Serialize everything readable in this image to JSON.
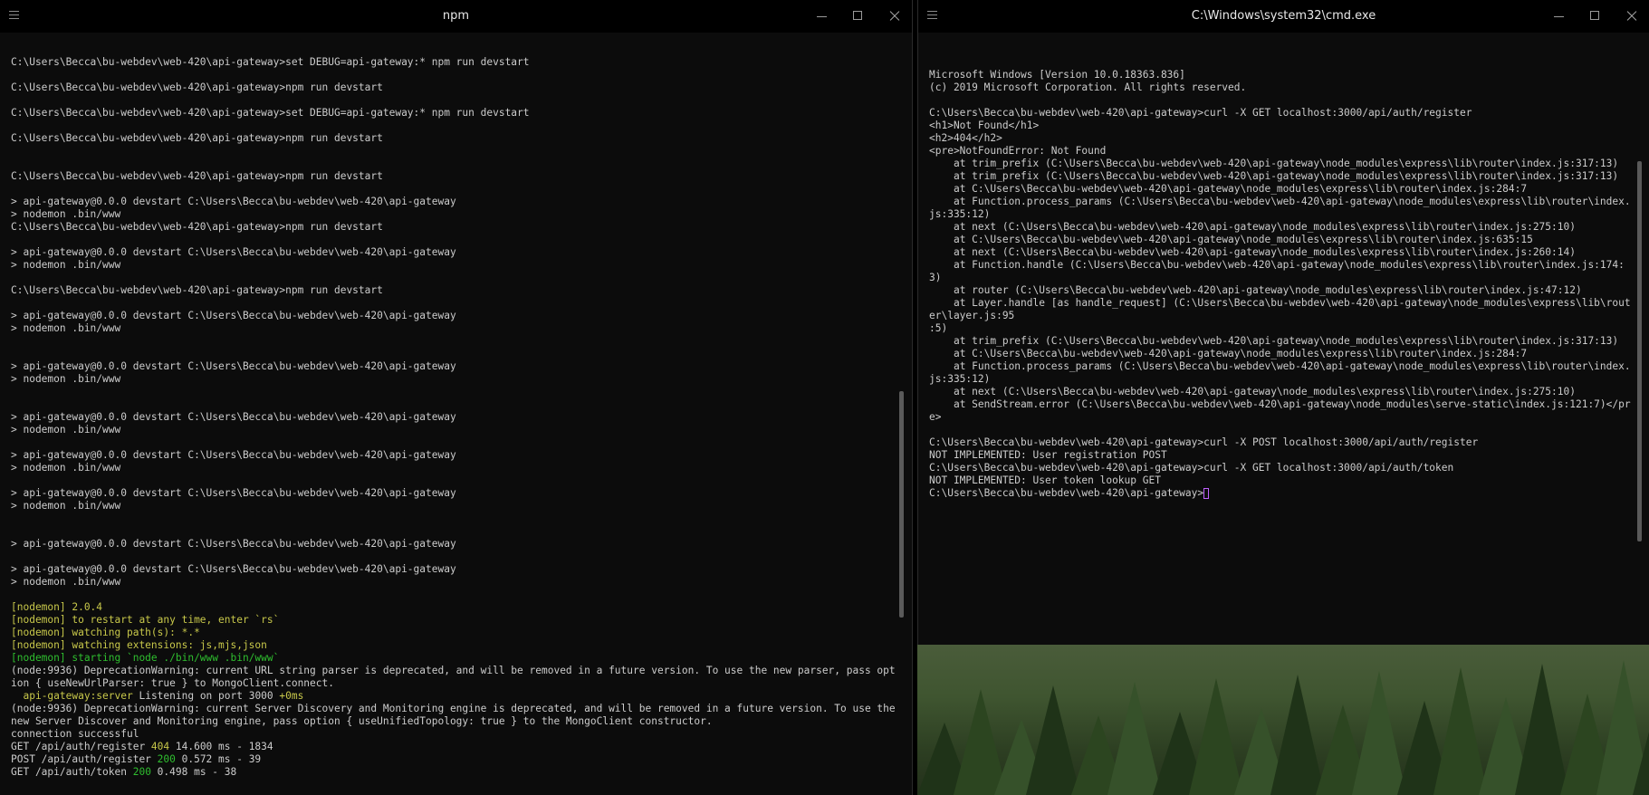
{
  "left_window": {
    "title": "npm",
    "lines": [
      {
        "t": "C:\\Users\\Becca\\bu-webdev\\web-420\\api-gateway>set DEBUG=api-gateway:* npm run devstart"
      },
      {
        "t": ""
      },
      {
        "t": "C:\\Users\\Becca\\bu-webdev\\web-420\\api-gateway>npm run devstart"
      },
      {
        "t": ""
      },
      {
        "t": "C:\\Users\\Becca\\bu-webdev\\web-420\\api-gateway>set DEBUG=api-gateway:* npm run devstart"
      },
      {
        "t": ""
      },
      {
        "t": "C:\\Users\\Becca\\bu-webdev\\web-420\\api-gateway>npm run devstart"
      },
      {
        "t": ""
      },
      {
        "t": ""
      },
      {
        "t": "C:\\Users\\Becca\\bu-webdev\\web-420\\api-gateway>npm run devstart"
      },
      {
        "t": ""
      },
      {
        "t": "> api-gateway@0.0.0 devstart C:\\Users\\Becca\\bu-webdev\\web-420\\api-gateway"
      },
      {
        "t": "> nodemon .bin/www"
      },
      {
        "t": "C:\\Users\\Becca\\bu-webdev\\web-420\\api-gateway>npm run devstart"
      },
      {
        "t": ""
      },
      {
        "t": "> api-gateway@0.0.0 devstart C:\\Users\\Becca\\bu-webdev\\web-420\\api-gateway"
      },
      {
        "t": "> nodemon .bin/www"
      },
      {
        "t": ""
      },
      {
        "t": "C:\\Users\\Becca\\bu-webdev\\web-420\\api-gateway>npm run devstart"
      },
      {
        "t": ""
      },
      {
        "t": "> api-gateway@0.0.0 devstart C:\\Users\\Becca\\bu-webdev\\web-420\\api-gateway"
      },
      {
        "t": "> nodemon .bin/www"
      },
      {
        "t": ""
      },
      {
        "t": ""
      },
      {
        "t": "> api-gateway@0.0.0 devstart C:\\Users\\Becca\\bu-webdev\\web-420\\api-gateway"
      },
      {
        "t": "> nodemon .bin/www"
      },
      {
        "t": ""
      },
      {
        "t": ""
      },
      {
        "t": "> api-gateway@0.0.0 devstart C:\\Users\\Becca\\bu-webdev\\web-420\\api-gateway"
      },
      {
        "t": "> nodemon .bin/www"
      },
      {
        "t": ""
      },
      {
        "t": "> api-gateway@0.0.0 devstart C:\\Users\\Becca\\bu-webdev\\web-420\\api-gateway"
      },
      {
        "t": "> nodemon .bin/www"
      },
      {
        "t": ""
      },
      {
        "t": "> api-gateway@0.0.0 devstart C:\\Users\\Becca\\bu-webdev\\web-420\\api-gateway"
      },
      {
        "t": "> nodemon .bin/www"
      },
      {
        "t": ""
      },
      {
        "t": ""
      },
      {
        "t": "> api-gateway@0.0.0 devstart C:\\Users\\Becca\\bu-webdev\\web-420\\api-gateway"
      },
      {
        "t": ""
      },
      {
        "t": "> api-gateway@0.0.0 devstart C:\\Users\\Becca\\bu-webdev\\web-420\\api-gateway"
      },
      {
        "t": "> nodemon .bin/www"
      },
      {
        "t": ""
      },
      {
        "t": "[nodemon] 2.0.4",
        "c": "y"
      },
      {
        "t": "[nodemon] to restart at any time, enter `rs`",
        "c": "y"
      },
      {
        "t": "[nodemon] watching path(s): *.*",
        "c": "y"
      },
      {
        "t": "[nodemon] watching extensions: js,mjs,json",
        "c": "y"
      },
      {
        "t": "[nodemon] starting `node ./bin/www .bin/www`",
        "c": "g"
      },
      {
        "t": "(node:9936) DeprecationWarning: current URL string parser is deprecated, and will be removed in a future version. To use the new parser, pass option { useNewUrlParser: true } to MongoClient.connect."
      },
      {
        "parts": [
          {
            "t": "  "
          },
          {
            "t": "api-gateway:server",
            "c": "y"
          },
          {
            "t": " Listening on port 3000 "
          },
          {
            "t": "+0ms",
            "c": "y"
          }
        ]
      },
      {
        "t": "(node:9936) DeprecationWarning: current Server Discovery and Monitoring engine is deprecated, and will be removed in a future version. To use the new Server Discover and Monitoring engine, pass option { useUnifiedTopology: true } to the MongoClient constructor."
      },
      {
        "t": "connection successful"
      },
      {
        "parts": [
          {
            "t": "GET /api/auth/register "
          },
          {
            "t": "404",
            "c": "y"
          },
          {
            "t": " 14.600 ms - 1834"
          }
        ]
      },
      {
        "parts": [
          {
            "t": "POST /api/auth/register "
          },
          {
            "t": "200",
            "c": "g"
          },
          {
            "t": " 0.572 ms - 39"
          }
        ]
      },
      {
        "parts": [
          {
            "t": "GET /api/auth/token "
          },
          {
            "t": "200",
            "c": "g"
          },
          {
            "t": " 0.498 ms - 38"
          }
        ]
      }
    ]
  },
  "right_window": {
    "title": "C:\\Windows\\system32\\cmd.exe",
    "lines": [
      {
        "t": "Microsoft Windows [Version 10.0.18363.836]"
      },
      {
        "t": "(c) 2019 Microsoft Corporation. All rights reserved."
      },
      {
        "t": ""
      },
      {
        "t": "C:\\Users\\Becca\\bu-webdev\\web-420\\api-gateway>curl -X GET localhost:3000/api/auth/register"
      },
      {
        "t": "<h1>Not Found</h1>"
      },
      {
        "t": "<h2>404</h2>"
      },
      {
        "t": "<pre>NotFoundError: Not Found"
      },
      {
        "t": "    at trim_prefix (C:\\Users\\Becca\\bu-webdev\\web-420\\api-gateway\\node_modules\\express\\lib\\router\\index.js:317:13)"
      },
      {
        "t": "    at trim_prefix (C:\\Users\\Becca\\bu-webdev\\web-420\\api-gateway\\node_modules\\express\\lib\\router\\index.js:317:13)"
      },
      {
        "t": "    at C:\\Users\\Becca\\bu-webdev\\web-420\\api-gateway\\node_modules\\express\\lib\\router\\index.js:284:7"
      },
      {
        "t": "    at Function.process_params (C:\\Users\\Becca\\bu-webdev\\web-420\\api-gateway\\node_modules\\express\\lib\\router\\index.js:335:12)"
      },
      {
        "t": "    at next (C:\\Users\\Becca\\bu-webdev\\web-420\\api-gateway\\node_modules\\express\\lib\\router\\index.js:275:10)"
      },
      {
        "t": "    at C:\\Users\\Becca\\bu-webdev\\web-420\\api-gateway\\node_modules\\express\\lib\\router\\index.js:635:15"
      },
      {
        "t": "    at next (C:\\Users\\Becca\\bu-webdev\\web-420\\api-gateway\\node_modules\\express\\lib\\router\\index.js:260:14)"
      },
      {
        "t": "    at Function.handle (C:\\Users\\Becca\\bu-webdev\\web-420\\api-gateway\\node_modules\\express\\lib\\router\\index.js:174:3)"
      },
      {
        "t": "    at router (C:\\Users\\Becca\\bu-webdev\\web-420\\api-gateway\\node_modules\\express\\lib\\router\\index.js:47:12)"
      },
      {
        "t": "    at Layer.handle [as handle_request] (C:\\Users\\Becca\\bu-webdev\\web-420\\api-gateway\\node_modules\\express\\lib\\router\\layer.js:95"
      },
      {
        "t": ":5)"
      },
      {
        "t": "    at trim_prefix (C:\\Users\\Becca\\bu-webdev\\web-420\\api-gateway\\node_modules\\express\\lib\\router\\index.js:317:13)"
      },
      {
        "t": "    at C:\\Users\\Becca\\bu-webdev\\web-420\\api-gateway\\node_modules\\express\\lib\\router\\index.js:284:7"
      },
      {
        "t": "    at Function.process_params (C:\\Users\\Becca\\bu-webdev\\web-420\\api-gateway\\node_modules\\express\\lib\\router\\index.js:335:12)"
      },
      {
        "t": "    at next (C:\\Users\\Becca\\bu-webdev\\web-420\\api-gateway\\node_modules\\express\\lib\\router\\index.js:275:10)"
      },
      {
        "t": "    at SendStream.error (C:\\Users\\Becca\\bu-webdev\\web-420\\api-gateway\\node_modules\\serve-static\\index.js:121:7)</pre>"
      },
      {
        "t": ""
      },
      {
        "t": "C:\\Users\\Becca\\bu-webdev\\web-420\\api-gateway>curl -X POST localhost:3000/api/auth/register"
      },
      {
        "t": "NOT IMPLEMENTED: User registration POST"
      },
      {
        "t": "C:\\Users\\Becca\\bu-webdev\\web-420\\api-gateway>curl -X GET localhost:3000/api/auth/token"
      },
      {
        "t": "NOT IMPLEMENTED: User token lookup GET"
      },
      {
        "t": "C:\\Users\\Becca\\bu-webdev\\web-420\\api-gateway>",
        "cursor": true
      }
    ]
  },
  "colors": {
    "background": "#0c0c0c",
    "text": "#cccccc",
    "yellow": "#c8c84a",
    "green": "#2fbf2f",
    "cursor": "#c060ff"
  },
  "icons": [
    "menu-icon",
    "minimize-icon",
    "maximize-icon",
    "close-icon"
  ]
}
